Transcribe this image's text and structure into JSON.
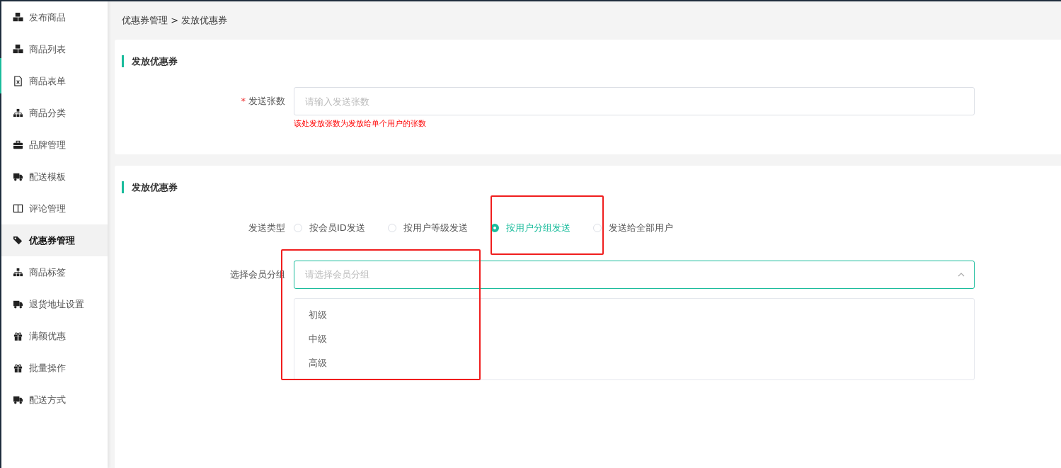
{
  "sidebar": {
    "items": [
      {
        "label": "发布商品",
        "selected": false
      },
      {
        "label": "商品列表",
        "selected": false
      },
      {
        "label": "商品表单",
        "selected": false
      },
      {
        "label": "商品分类",
        "selected": false
      },
      {
        "label": "品牌管理",
        "selected": false
      },
      {
        "label": "配送模板",
        "selected": false
      },
      {
        "label": "评论管理",
        "selected": false
      },
      {
        "label": "优惠券管理",
        "selected": true
      },
      {
        "label": "商品标签",
        "selected": false
      },
      {
        "label": "退货地址设置",
        "selected": false
      },
      {
        "label": "满额优惠",
        "selected": false
      },
      {
        "label": "批量操作",
        "selected": false
      },
      {
        "label": "配送方式",
        "selected": false
      }
    ]
  },
  "breadcrumb": "优惠券管理 > 发放优惠券",
  "section_1": {
    "title": "发放优惠券",
    "field": {
      "required_mark": "*",
      "label": "发送张数",
      "placeholder": "请输入发送张数",
      "hint": "该处发放张数为发放给单个用户的张数"
    }
  },
  "section_2": {
    "title": "发放优惠券",
    "send_type": {
      "label": "发送类型",
      "options": [
        {
          "label": "按会员ID发送",
          "selected": false
        },
        {
          "label": "按用户等级发送",
          "selected": false
        },
        {
          "label": "按用户分组发送",
          "selected": true
        },
        {
          "label": "发送给全部用户",
          "selected": false
        }
      ]
    },
    "group_select": {
      "label": "选择会员分组",
      "placeholder": "请选择会员分组",
      "expanded": true,
      "options": [
        "初级",
        "中级",
        "高级"
      ]
    }
  }
}
